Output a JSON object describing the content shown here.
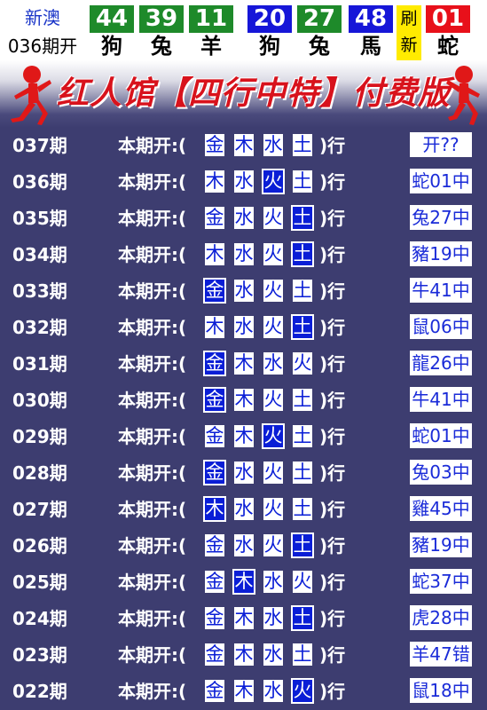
{
  "header": {
    "label_line1": "新澳",
    "label_line2": "036期开",
    "balls": [
      {
        "number": "44",
        "zodiac": "狗",
        "color": "#1e8a2a"
      },
      {
        "number": "39",
        "zodiac": "兔",
        "color": "#1e8a2a"
      },
      {
        "number": "11",
        "zodiac": "羊",
        "color": "#1e8a2a"
      },
      {
        "number": "20",
        "zodiac": "狗",
        "color": "#1616d8"
      },
      {
        "number": "27",
        "zodiac": "兔",
        "color": "#1e8a2a"
      },
      {
        "number": "48",
        "zodiac": "馬",
        "color": "#1616d8"
      }
    ],
    "refresh_line1": "刷",
    "refresh_line2": "新",
    "special": {
      "number": "01",
      "zodiac": "蛇",
      "color": "#e8101a"
    }
  },
  "banner": {
    "title": "红人馆【四行中特】付费版"
  },
  "row_prefix": "本期开:(",
  "row_suffix": ")行",
  "rows": [
    {
      "period": "037期",
      "elements": [
        "金",
        "木",
        "水",
        "土"
      ],
      "highlight": -1,
      "result": "开??"
    },
    {
      "period": "036期",
      "elements": [
        "木",
        "水",
        "火",
        "土"
      ],
      "highlight": 2,
      "result": "蛇01中"
    },
    {
      "period": "035期",
      "elements": [
        "金",
        "水",
        "火",
        "土"
      ],
      "highlight": 3,
      "result": "兔27中"
    },
    {
      "period": "034期",
      "elements": [
        "木",
        "水",
        "火",
        "土"
      ],
      "highlight": 3,
      "result": "豬19中"
    },
    {
      "period": "033期",
      "elements": [
        "金",
        "水",
        "火",
        "土"
      ],
      "highlight": 0,
      "result": "牛41中"
    },
    {
      "period": "032期",
      "elements": [
        "木",
        "水",
        "火",
        "土"
      ],
      "highlight": 3,
      "result": "鼠06中"
    },
    {
      "period": "031期",
      "elements": [
        "金",
        "木",
        "水",
        "火"
      ],
      "highlight": 0,
      "result": "龍26中"
    },
    {
      "period": "030期",
      "elements": [
        "金",
        "木",
        "火",
        "土"
      ],
      "highlight": 0,
      "result": "牛41中"
    },
    {
      "period": "029期",
      "elements": [
        "金",
        "木",
        "火",
        "土"
      ],
      "highlight": 2,
      "result": "蛇01中"
    },
    {
      "period": "028期",
      "elements": [
        "金",
        "水",
        "火",
        "土"
      ],
      "highlight": 0,
      "result": "兔03中"
    },
    {
      "period": "027期",
      "elements": [
        "木",
        "水",
        "火",
        "土"
      ],
      "highlight": 0,
      "result": "雞45中"
    },
    {
      "period": "026期",
      "elements": [
        "金",
        "水",
        "火",
        "土"
      ],
      "highlight": 3,
      "result": "豬19中"
    },
    {
      "period": "025期",
      "elements": [
        "金",
        "木",
        "水",
        "火"
      ],
      "highlight": 1,
      "result": "蛇37中"
    },
    {
      "period": "024期",
      "elements": [
        "金",
        "木",
        "水",
        "土"
      ],
      "highlight": 3,
      "result": "虎28中"
    },
    {
      "period": "023期",
      "elements": [
        "金",
        "木",
        "水",
        "土"
      ],
      "highlight": -1,
      "result": "羊47错"
    },
    {
      "period": "022期",
      "elements": [
        "金",
        "木",
        "水",
        "火"
      ],
      "highlight": 3,
      "result": "鼠18中"
    }
  ]
}
